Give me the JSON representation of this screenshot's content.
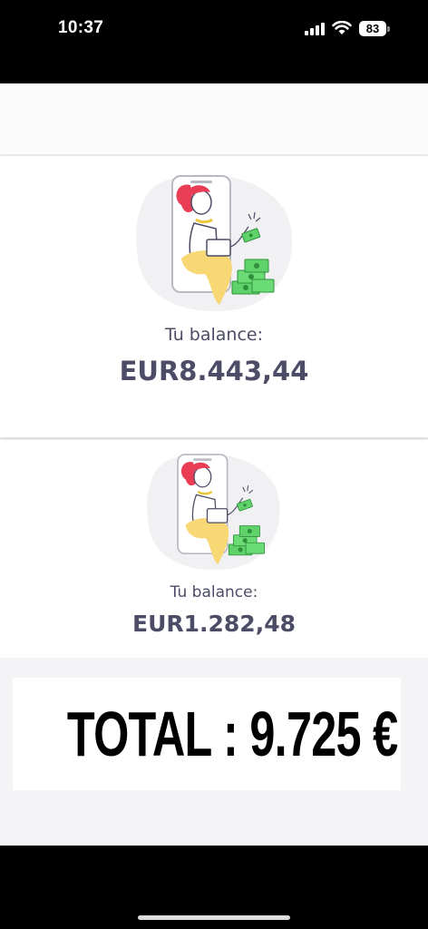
{
  "status_bar": {
    "time": "10:37",
    "battery": "83"
  },
  "cards": [
    {
      "label": "Tu balance:",
      "amount": "EUR8.443,44"
    },
    {
      "label": "Tu balance:",
      "amount": "EUR1.282,48"
    }
  ],
  "total": {
    "text": "TOTAL :  9.725 €"
  },
  "icons": [
    "cellular-signal-icon",
    "wifi-icon",
    "battery-icon",
    "balance-illustration"
  ]
}
